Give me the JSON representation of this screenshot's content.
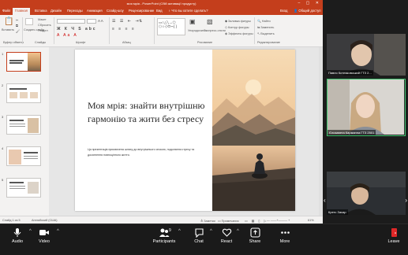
{
  "powerpoint": {
    "title": "моя мрія - PowerPoint (Сбій активації продукту)",
    "tabs": [
      {
        "label": "Файл"
      },
      {
        "label": "Главная"
      },
      {
        "label": "Вставка"
      },
      {
        "label": "Дизайн"
      },
      {
        "label": "Переходы"
      },
      {
        "label": "Анимация"
      },
      {
        "label": "Слайд-шоу"
      },
      {
        "label": "Рецензирование"
      },
      {
        "label": "Вид"
      },
      {
        "label": "Что вы хотите сделать?"
      }
    ],
    "account": "Вход",
    "share": "Общий доступ",
    "ribbon": {
      "paste": "Вставить",
      "create_slide": "Создать слайд",
      "layout": "Макет",
      "reset": "Сбросить",
      "section": "Раздел",
      "arrange": "Упорядочить",
      "express_styles": "Экспресс-стили",
      "shape_fill": "Заливка фигуры",
      "shape_outline": "Контур фигуры",
      "shape_effects": "Эффекты фигуры",
      "find": "Найти",
      "replace": "Заменить",
      "select": "Выделить",
      "group_clipboard": "Буфер обмена",
      "group_slides": "Слайды",
      "group_font": "Шрифт",
      "group_paragraph": "Абзац",
      "group_drawing": "Рисование",
      "group_editing": "Редактирование"
    },
    "thumbnails": [
      {
        "num": "1"
      },
      {
        "num": "2"
      },
      {
        "num": "3"
      },
      {
        "num": "4"
      },
      {
        "num": "5"
      }
    ],
    "slide": {
      "title": "Моя мрія: знайти внутрішню гармонію та жити без стресу",
      "body": "Ця презентація присвячена шляху до внутрішнього спокою, подолання стресу та досягнення повноцінного життя."
    },
    "status": {
      "slide_count": "Слайд 1 из 5",
      "language": "Английский (США)",
      "notes": "Заметки",
      "comments": "Примечания",
      "zoom": "61%"
    }
  },
  "participants": [
    {
      "name": "Павло Котляковський ГТЗ 2..."
    },
    {
      "name": "Єлизавета Карманна ГТЗ 2501"
    },
    {
      "name": "Кретс Захар"
    }
  ],
  "toolbar": {
    "audio": "Audio",
    "video": "Video",
    "participants": "Participants",
    "participants_count": "9",
    "chat": "Chat",
    "react": "React",
    "share": "Share",
    "more": "More",
    "leave": "Leave"
  },
  "colors": {
    "ppt_accent": "#c43e1c",
    "active_speaker": "#3ec46d",
    "leave_red": "#e02828"
  }
}
